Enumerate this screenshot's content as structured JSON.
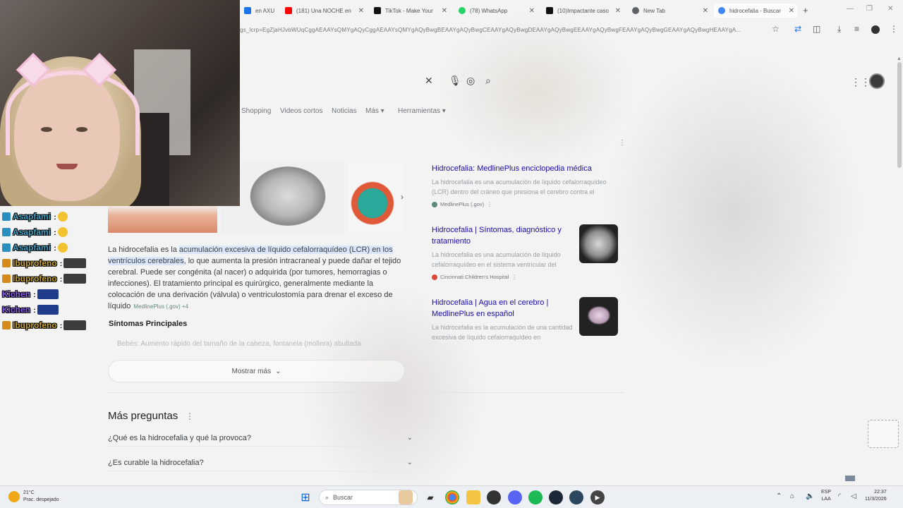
{
  "browser": {
    "tabs": [
      {
        "title": "en AXU",
        "color": "#1a73e8"
      },
      {
        "title": "(181) Una NOCHE en",
        "color": "#ff0000"
      },
      {
        "title": "TikTok - Make Your",
        "color": "#111111"
      },
      {
        "title": "(78) WhatsApp",
        "color": "#25d366"
      },
      {
        "title": "(10)Impactante caso",
        "color": "#111111"
      },
      {
        "title": "New Tab",
        "color": "#5f6368"
      },
      {
        "title": "hidrocefalia - Buscar",
        "color": "#4285f4"
      }
    ],
    "close_glyph": "✕",
    "new_tab_glyph": "+",
    "window_controls": [
      "—",
      "❐",
      "✕"
    ],
    "address": "gs_lcrp=EgZjaHJvbWUqCggAEAAYsQMYgAQyCggAEAAYsQMYgAQyBwgBEAAYgAQyBwgCEAAYgAQyBwgDEAAYgAQyBwgEEAAYgAQyBwgFEAAYgAQyBwgGEAAYgAQyBwgHEAAYgA...",
    "toolbar_icons": [
      "star-icon",
      "translate-icon",
      "extensions-icon",
      "download-icon",
      "media-icon",
      "profile-icon",
      "menu-icon"
    ]
  },
  "search": {
    "nav": [
      "Shopping",
      "Videos cortos",
      "Noticias",
      "Más ▾",
      "Herramientas ▾"
    ]
  },
  "chat": [
    {
      "user": "Asapfami",
      "color": "#3fa3c7",
      "badge": "#2a8fbf"
    },
    {
      "user": "Asapfami",
      "color": "#3fa3c7",
      "badge": "#2a8fbf"
    },
    {
      "user": "Asapfami",
      "color": "#3fa3c7",
      "badge": "#2a8fbf"
    },
    {
      "user": "Ibuprofeno",
      "color": "#c9a227",
      "badge": "#d48a1a"
    },
    {
      "user": "Ibuprofeno",
      "color": "#c9a227",
      "badge": "#d48a1a"
    },
    {
      "user": "Kichen",
      "color": "#8a5cf0",
      "badge": "#5a8ff0"
    },
    {
      "user": "Kichen",
      "color": "#8a5cf0",
      "badge": "#5a8ff0"
    },
    {
      "user": "Ibuprofeno",
      "color": "#c9a227",
      "badge": "#d48a1a"
    }
  ],
  "chat_sep": ":",
  "result": {
    "snippet_pre": "La hidrocefalia es la ",
    "snippet_hl": "acumulación excesiva de líquido cefalorraquídeo (LCR) en los ventrículos cerebrales",
    "snippet_post": ", lo que aumenta la presión intracraneal y puede dañar el tejido cerebral. Puede ser congénita (al nacer) o adquirida (por tumores, hemorragias o infecciones). El tratamiento principal es quirúrgico, generalmente mediante la colocación de una derivación (válvula) o ventriculostomía para drenar el exceso de líquido",
    "snippet_source": "MedlinePlus (.gov) +4",
    "symptoms_heading": "Síntomas Principales",
    "faded_line": "Bebés: Aumento rápido del tamaño de la cabeza, fontanela (mollera) abultada",
    "show_more": "Mostrar más",
    "paa_title": "Más preguntas",
    "paa_questions": [
      "¿Qué es la hidrocefalia y qué la provoca?",
      "¿Es curable la hidrocefalia?"
    ]
  },
  "right_panel": [
    {
      "title": "Hidrocefalia: MedlinePlus enciclopedia médica",
      "desc": "La hidrocefalia es una acumulación de líquido cefalorraquídeo (LCR) dentro del cráneo que presiona el cerebro contra el",
      "source": "MedlinePlus (.gov)",
      "dot": "#5f8a7a"
    },
    {
      "title": "Hidrocefalia | Síntomas, diagnóstico y tratamiento",
      "desc": "La hidrocefalia es una acumulación de líquido cefalorraquídeo en el sistema ventricular del",
      "source": "Cincinnati Children's Hospital",
      "dot": "#d94a3a"
    },
    {
      "title": "Hidrocefalia | Agua en el cerebro | MedlinePlus en español",
      "desc": "La hidrocefalia es la acumulación de una cantidad excesiva de líquido cefalorraquídeo en",
      "source": "",
      "dot": ""
    }
  ],
  "taskbar": {
    "weather_temp": "21°C",
    "weather_desc": "Prac. despejado",
    "search_placeholder": "Buscar",
    "lang_top": "ESP",
    "lang_bottom": "LAA",
    "time": "22:37",
    "date": "11/3/2026"
  }
}
